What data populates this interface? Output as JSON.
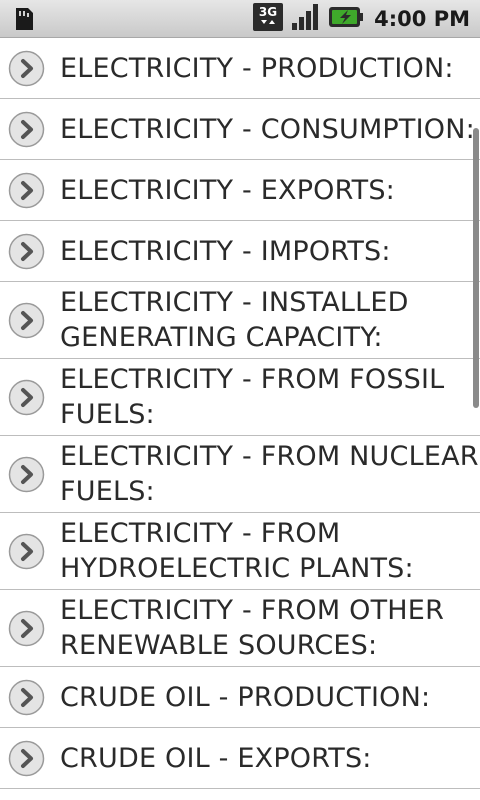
{
  "status_bar": {
    "time": "4:00 PM",
    "network": "3G"
  },
  "list": {
    "items": [
      {
        "label": "ELECTRICITY - PRODUCTION:"
      },
      {
        "label": "ELECTRICITY - CONSUMPTION:"
      },
      {
        "label": "ELECTRICITY - EXPORTS:"
      },
      {
        "label": "ELECTRICITY - IMPORTS:"
      },
      {
        "label": "ELECTRICITY - INSTALLED\nGENERATING CAPACITY:"
      },
      {
        "label": "ELECTRICITY - FROM FOSSIL\nFUELS:"
      },
      {
        "label": "ELECTRICITY - FROM NUCLEAR\nFUELS:"
      },
      {
        "label": "ELECTRICITY - FROM\nHYDROELECTRIC PLANTS:"
      },
      {
        "label": "ELECTRICITY - FROM OTHER\nRENEWABLE SOURCES:"
      },
      {
        "label": "CRUDE OIL - PRODUCTION:"
      },
      {
        "label": "CRUDE OIL - EXPORTS:"
      }
    ]
  },
  "colors": {
    "chevron": "#555555",
    "battery": "#3fa92b",
    "divider": "#bdbdbd"
  }
}
